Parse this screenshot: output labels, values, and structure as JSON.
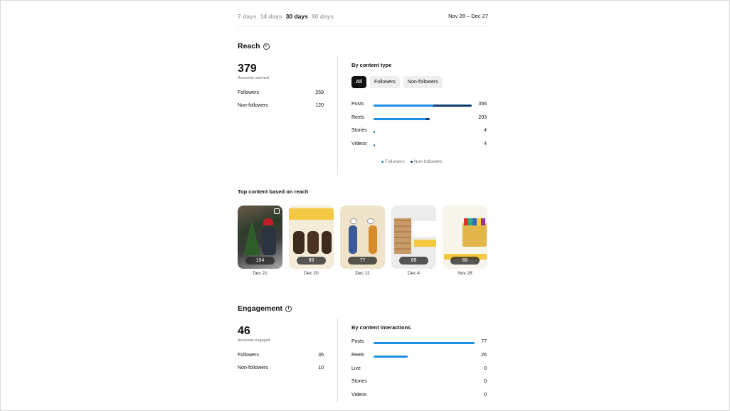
{
  "tabs": [
    "7 days",
    "14 days",
    "30 days",
    "90 days"
  ],
  "active_tab": 2,
  "date_range": "Nov 28 – Dec 27",
  "reach": {
    "title": "Reach",
    "total": "379",
    "total_label": "Accounts reached",
    "followers_label": "Followers",
    "followers_value": "259",
    "nonfollowers_label": "Non-followers",
    "nonfollowers_value": "120",
    "by_type_title": "By content type",
    "chips": [
      "All",
      "Followers",
      "Non-followers"
    ],
    "rows": [
      {
        "label": "Posts",
        "value": "356",
        "followers": 217,
        "nonfollowers": 139
      },
      {
        "label": "Reels",
        "value": "203",
        "followers": 190,
        "nonfollowers": 13
      },
      {
        "label": "Stories",
        "value": "4",
        "followers": 4,
        "nonfollowers": 0
      },
      {
        "label": "Videos",
        "value": "4",
        "followers": 4,
        "nonfollowers": 0
      }
    ],
    "legend": [
      "Followers",
      "Non-followers"
    ]
  },
  "top_content": {
    "title": "Top content based on reach",
    "items": [
      {
        "value": "194",
        "date": "Dec 21"
      },
      {
        "value": "86",
        "date": "Dec 20"
      },
      {
        "value": "77",
        "date": "Dec 12"
      },
      {
        "value": "68",
        "date": "Dec 4"
      },
      {
        "value": "68",
        "date": "Nov 28"
      }
    ]
  },
  "engagement": {
    "title": "Engagement",
    "total": "46",
    "total_label": "Accounts engaged",
    "followers_label": "Followers",
    "followers_value": "36",
    "nonfollowers_label": "Non-followers",
    "nonfollowers_value": "10",
    "by_interactions_title": "By content interactions",
    "rows": [
      {
        "label": "Posts",
        "value": "77",
        "amount": 77
      },
      {
        "label": "Reels",
        "value": "26",
        "amount": 26
      },
      {
        "label": "Live",
        "value": "0",
        "amount": 0
      },
      {
        "label": "Stories",
        "value": "0",
        "amount": 0
      },
      {
        "label": "Videos",
        "value": "0",
        "amount": 0
      }
    ]
  },
  "colors": {
    "followers": "#1b8fe3",
    "nonfollowers": "#0d3a73"
  }
}
